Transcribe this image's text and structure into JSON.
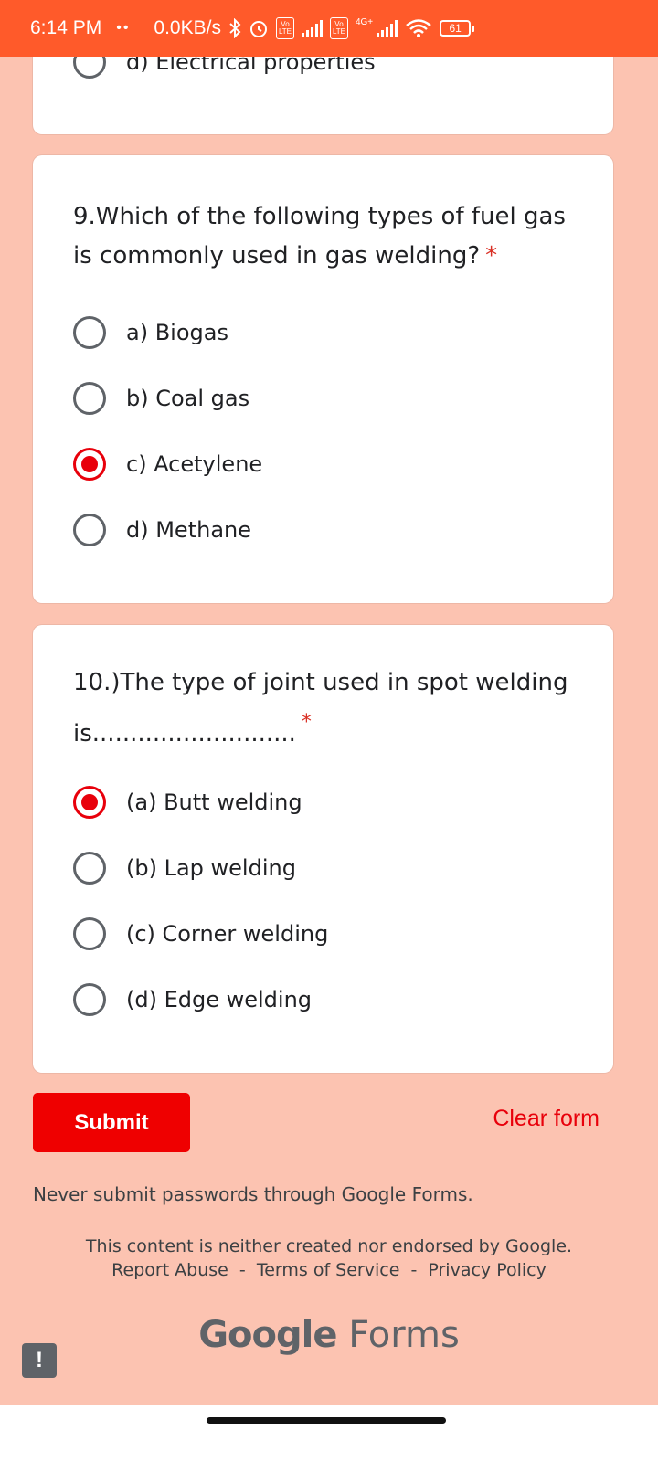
{
  "status_bar": {
    "time": "6:14 PM",
    "dots": "••",
    "network_speed": "0.0KB/s",
    "lte_label_1": "Vo LTE",
    "lte_label_2": "Vo LTE",
    "network_type": "4G+",
    "battery": "61"
  },
  "previous_question": {
    "option_label": "d) Electrical properties"
  },
  "question9": {
    "title": "9.Which of the following types of fuel gas is commonly used in gas welding?",
    "required_mark": "*",
    "options": [
      {
        "label": "a) Biogas",
        "selected": false
      },
      {
        "label": "b) Coal gas",
        "selected": false
      },
      {
        "label": "c) Acetylene",
        "selected": true
      },
      {
        "label": "d) Methane",
        "selected": false
      }
    ]
  },
  "question10": {
    "title_line1": "10.)The type of joint used in spot welding",
    "title_line2": "is...........................",
    "required_mark": "*",
    "options": [
      {
        "label": "(a) Butt welding",
        "selected": true
      },
      {
        "label": "(b) Lap welding",
        "selected": false
      },
      {
        "label": "(c) Corner welding",
        "selected": false
      },
      {
        "label": "(d) Edge welding",
        "selected": false
      }
    ]
  },
  "actions": {
    "submit_label": "Submit",
    "clear_label": "Clear form"
  },
  "footer": {
    "warning": "Never submit passwords through Google Forms.",
    "disclaimer": "This content is neither created nor endorsed by Google.",
    "links": [
      "Report Abuse",
      "Terms of Service",
      "Privacy Policy"
    ],
    "separator": "-",
    "brand_google": "Google",
    "brand_forms": "Forms"
  },
  "report_button_icon": "!",
  "colors": {
    "status_bar": "#ff5a2a",
    "background": "#fcc3b1",
    "accent": "#e8000b",
    "submit": "#ef0000"
  }
}
